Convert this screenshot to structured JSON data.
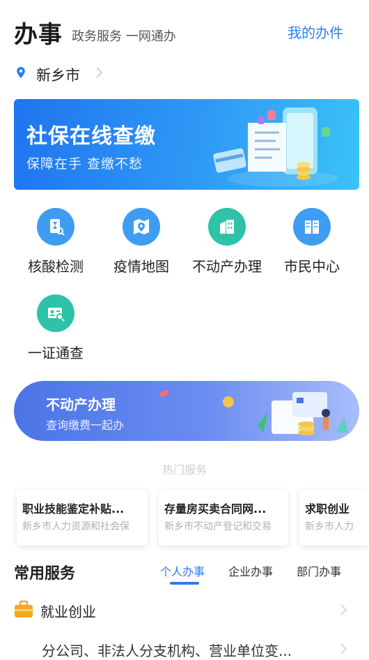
{
  "header": {
    "title": "办事",
    "subtitle": "政务服务 一网通办",
    "my_work": "我的办件"
  },
  "location": {
    "city": "新乡市"
  },
  "banner": {
    "title": "社保在线查缴",
    "subtitle": "保障在手  查缴不愁"
  },
  "grid": [
    {
      "label": "核酸检测",
      "icon": "test-tube-document-icon",
      "color": "#3e9cf2"
    },
    {
      "label": "疫情地图",
      "icon": "map-pin-icon",
      "color": "#3e9cf2"
    },
    {
      "label": "不动产办理",
      "icon": "building-document-icon",
      "color": "#2ec3a6"
    },
    {
      "label": "市民中心",
      "icon": "building-icon",
      "color": "#3e9cf2"
    },
    {
      "label": "一证通查",
      "icon": "id-card-search-icon",
      "color": "#2ec3a6"
    }
  ],
  "promo": {
    "title": "不动产办理",
    "subtitle": "查询缴费一起办"
  },
  "hot_services": {
    "title": "热门服务",
    "cards": [
      {
        "title": "职业技能鉴定补贴...",
        "sub": "新乡市人力资源和社会保"
      },
      {
        "title": "存量房买卖合同网...",
        "sub": "新乡市不动产登记和交易"
      },
      {
        "title": "求职创业",
        "sub": "新乡市人力"
      }
    ]
  },
  "common_services": {
    "title": "常用服务",
    "tabs": [
      "个人办事",
      "企业办事",
      "部门办事"
    ],
    "active_tab": "个人办事",
    "category": "就业创业",
    "item": "分公司、非法人分支机构、营业单位变..."
  },
  "colors": {
    "accent": "#2a7ef4",
    "teal": "#2ec3a6",
    "briefcase": "#f5a623"
  }
}
